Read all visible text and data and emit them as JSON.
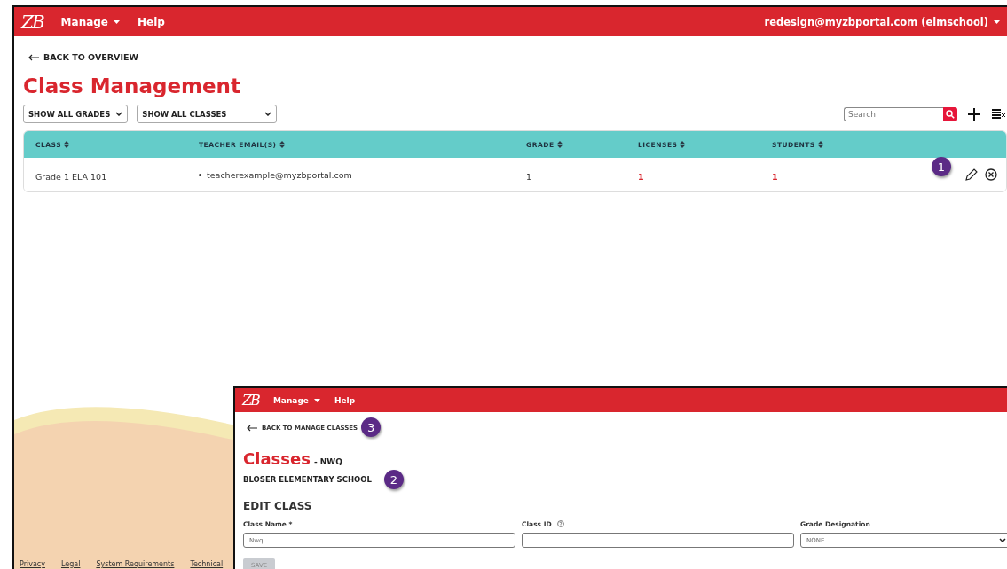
{
  "main": {
    "header": {
      "logo": "ZB",
      "menu": [
        {
          "label": "Manage",
          "dropdown": true
        },
        {
          "label": "Help",
          "dropdown": false
        }
      ],
      "user": "redesign@myzbportal.com (elmschool)"
    },
    "back_link": "BACK TO OVERVIEW",
    "title": "Class Management",
    "filters": [
      {
        "value": "SHOW ALL GRADES"
      },
      {
        "value": "SHOW ALL CLASSES"
      }
    ],
    "search": {
      "placeholder": "Search"
    },
    "table": {
      "columns": [
        "CLASS",
        "TEACHER EMAIL(S)",
        "GRADE",
        "LICENSES",
        "STUDENTS"
      ],
      "rows": [
        {
          "cells": [
            {
              "kind": "text",
              "text": "Grade 1 ELA 101"
            },
            {
              "kind": "bullet",
              "text": "teacherexample@myzbportal.com"
            },
            {
              "kind": "text",
              "text": "1"
            },
            {
              "kind": "link",
              "text": "1"
            },
            {
              "kind": "link",
              "text": "1"
            }
          ]
        }
      ]
    },
    "footer_links": [
      "Privacy",
      "Legal",
      "System Requirements",
      "Technical"
    ]
  },
  "inset": {
    "header": {
      "logo": "ZB",
      "menu": [
        {
          "label": "Manage",
          "dropdown": true
        },
        {
          "label": "Help",
          "dropdown": false
        }
      ]
    },
    "back_link": "BACK TO MANAGE CLASSES",
    "title": "Classes",
    "subtitle": "- NWQ",
    "school": "BLOSER ELEMENTARY SCHOOL",
    "section": "EDIT CLASS",
    "fields": [
      {
        "label": "Class Name *",
        "kind": "text",
        "value": "Nwq"
      },
      {
        "label": "Class ID",
        "kind": "text",
        "help": true
      },
      {
        "label": "Grade Designation",
        "kind": "select",
        "value": "NONE"
      }
    ],
    "save_button": {
      "label": "SAVE",
      "disabled": true
    }
  },
  "callouts": [
    {
      "number": "1"
    },
    {
      "number": "2"
    },
    {
      "number": "3"
    }
  ]
}
